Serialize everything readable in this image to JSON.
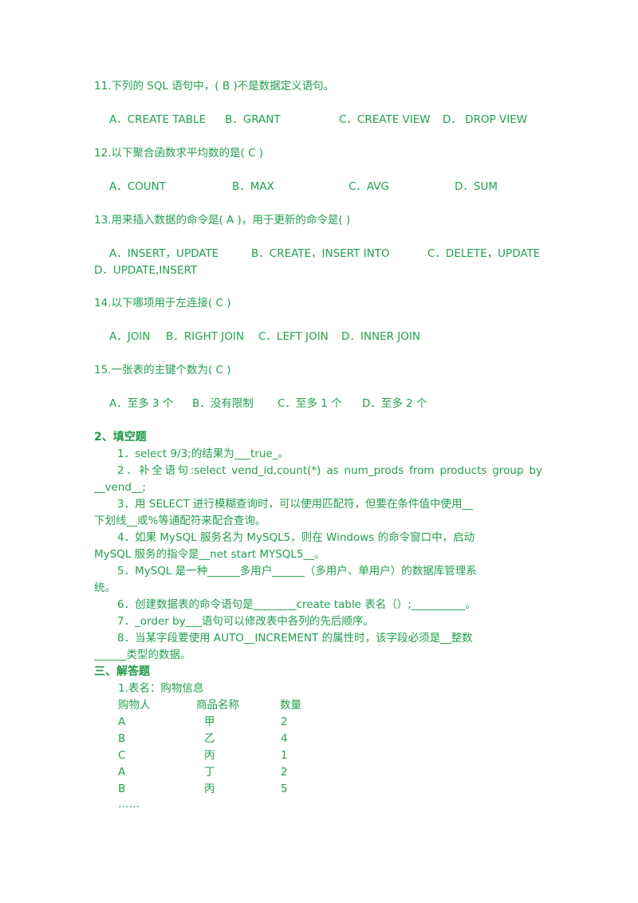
{
  "colors": {
    "text": "#22a04e",
    "heading": "#1f9a48",
    "background": "#ffffff"
  },
  "choice_questions": [
    {
      "stem": "11.下列的 SQL 语句中，(     B        )不是数据定义语句。",
      "options": [
        "A．CREATE TABLE",
        "B．GRANT",
        "C．CREATE VIEW",
        "D．  DROP VIEW"
      ]
    },
    {
      "stem": "12.以下聚合函数求平均数的是(      C      )",
      "options": [
        "A．COUNT",
        "B．MAX",
        "C．AVG",
        "D．SUM"
      ]
    },
    {
      "stem": "13.用来插入数据的命令是(      A      )，用于更新的命令是(            )",
      "options": [
        "A．INSERT，UPDATE",
        "B．CREATE，INSERT    INTO",
        "C．DELETE，UPDATE",
        "D．UPDATE,INSERT"
      ]
    },
    {
      "stem": "14.以下哪项用于左连接(        C    )",
      "options": [
        "A．JOIN",
        "B．RIGHT JOIN",
        "C．LEFT JOIN",
        "D．INNER JOIN"
      ]
    },
    {
      "stem": "15.一张表的主键个数为(      C      )",
      "options": [
        "A．至多 3 个",
        "B．没有限制",
        "C．至多 1 个",
        "D．至多 2 个"
      ]
    }
  ],
  "fill_section": {
    "title": "2、填空题",
    "items": [
      {
        "first": "1．select 9/3;的结果为___true_。",
        "rest": ""
      },
      {
        "first": "2．补全语句:select  vend_id,count(*)  as  num_prods  from  products  group  by",
        "rest": "__vend__;"
      },
      {
        "first": "3．用 SELECT 进行模糊查询时，可以使用匹配符，但要在条件值中使用__",
        "rest": "下划线__或%等通配符来配合查询。"
      },
      {
        "first": "4．如果 MySQL 服务名为 MySQL5，则在 Windows 的命令窗口中，启动",
        "rest": "MySQL 服务的指令是__net start MYSQL5__。"
      },
      {
        "first": "5．MySQL 是一种______多用户______（多用户、单用户）的数据库管理系",
        "rest": "统。"
      },
      {
        "first": "6．创建数据表的命令语句是________create table  表名（）;__________。",
        "rest": ""
      },
      {
        "first": "7．_order by___语句可以修改表中各列的先后顺序。",
        "rest": ""
      },
      {
        "first": "8．当某字段要使用 AUTO__INCREMENT 的属性时，该字段必须是__整数",
        "rest": "______类型的数据。"
      }
    ]
  },
  "answer_section": {
    "title": "三、解答题",
    "table_title": "1.表名：购物信息",
    "columns": [
      "购物人",
      "商品名称",
      "数量"
    ],
    "rows": [
      [
        "A",
        "甲",
        "2"
      ],
      [
        "B",
        "乙",
        "4"
      ],
      [
        "C",
        "丙",
        "1"
      ],
      [
        "A",
        "丁",
        "2"
      ],
      [
        "B",
        "丙",
        "5"
      ]
    ],
    "ellipsis": "……"
  }
}
